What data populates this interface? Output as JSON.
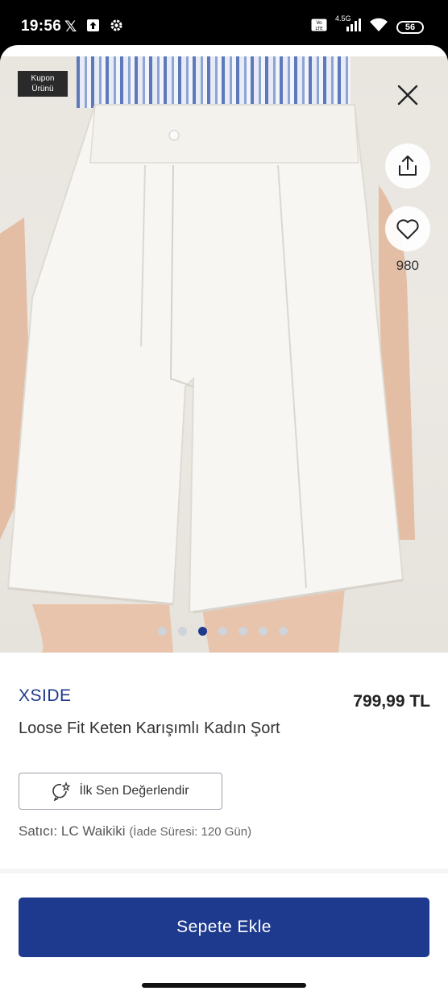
{
  "status_bar": {
    "time": "19:56",
    "network": "4.5G",
    "battery": "56"
  },
  "product_image": {
    "coupon_badge": "Kupon\nÜrünü",
    "favorite_count": "980",
    "carousel_total": 7,
    "carousel_active": 3
  },
  "product": {
    "brand": "XSIDE",
    "price": "799,99 TL",
    "title": "Loose Fit Keten Karışımlı Kadın Şort",
    "review_button": "İlk Sen Değerlendir",
    "seller_prefix": "Satıcı: ",
    "seller_name": "LC Waikiki",
    "return_info": "(İade Süresi: 120 Gün)"
  },
  "actions": {
    "add_to_cart": "Sepete Ekle"
  },
  "colors": {
    "brand_blue": "#1e3a8a",
    "button_blue": "#1e3a8f"
  }
}
